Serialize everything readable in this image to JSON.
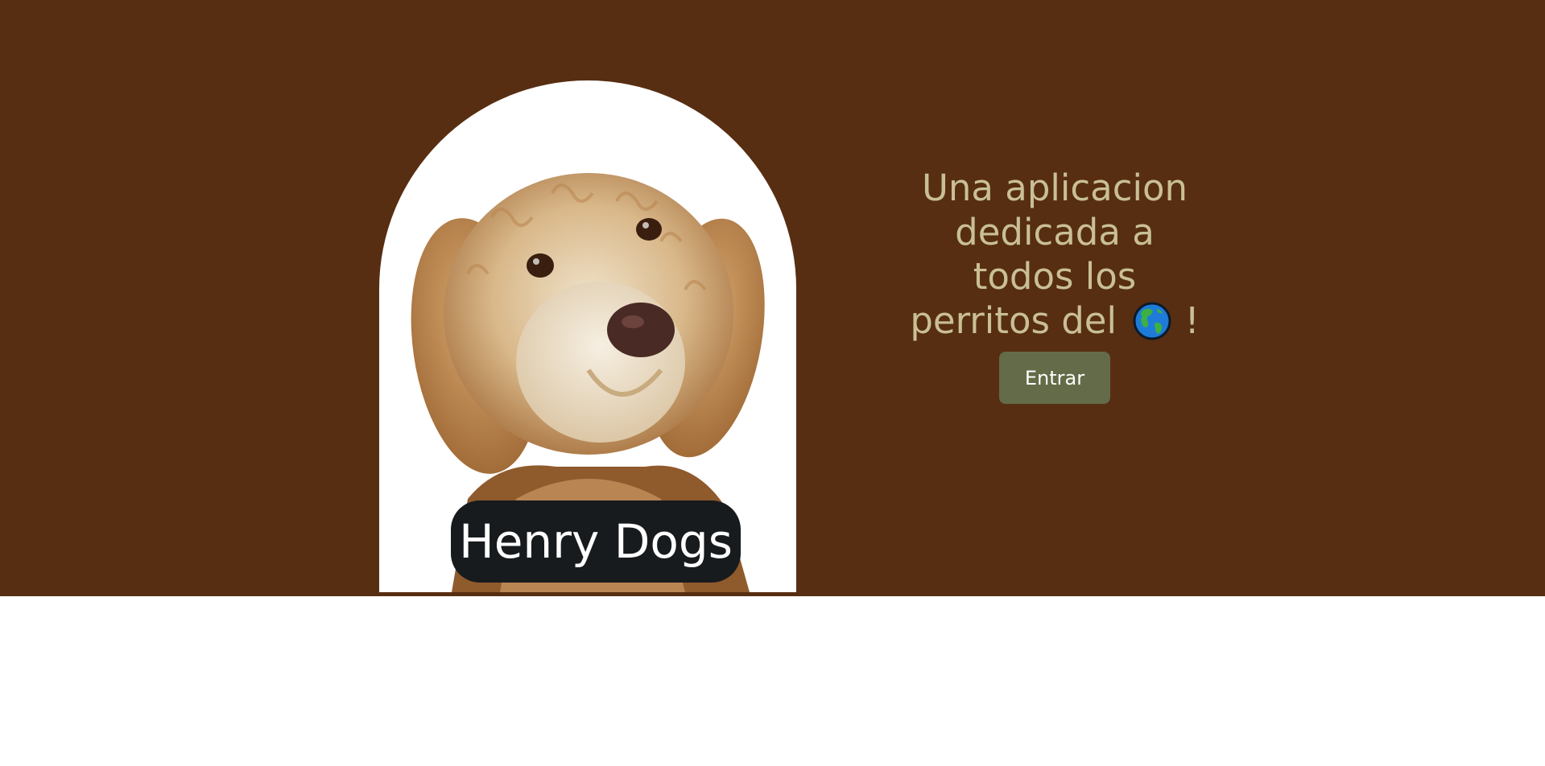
{
  "hero": {
    "background_color": "#572e12",
    "image": {
      "alt": "dog-illustration"
    },
    "brand_name": "Henry Dogs",
    "headline": {
      "line1": "Una aplicacion",
      "line2": "dedicada a",
      "line3": "todos los",
      "line4_prefix": "perritos del",
      "line4_icon": "globe-americas-icon",
      "line4_suffix": "!"
    },
    "enter_button_label": "Entrar",
    "accent_colors": {
      "text": "#c9bf94",
      "button": "#636b48",
      "badge": "#171b1e"
    }
  }
}
